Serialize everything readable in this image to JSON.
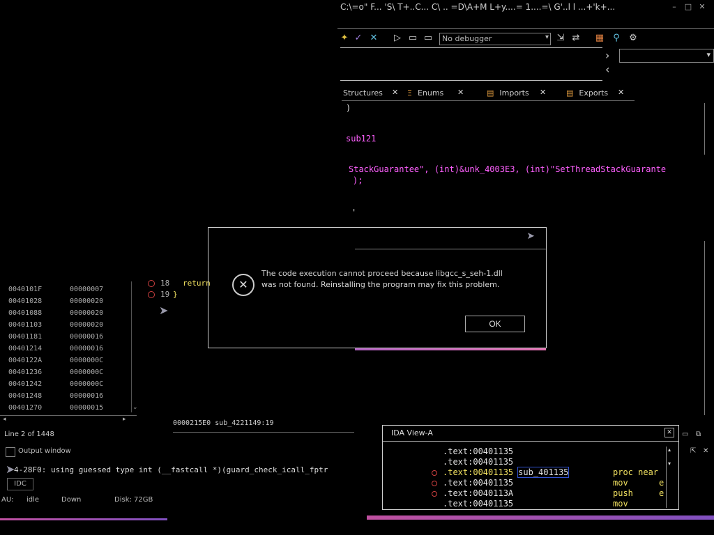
{
  "window": {
    "title": "C:\\=o\" F... 'S\\ T+..C... C\\ .. =D\\A+M L+y....= 1....=\\ G'..l  l ...+'k+...",
    "controls": [
      "–",
      "□",
      "✕"
    ]
  },
  "toolbar": {
    "debugger_select": "No debugger",
    "icons": [
      "wand-icon",
      "check-icon",
      "cross-icon",
      "play-icon",
      "pause-icon",
      "stop-icon",
      "step-icon",
      "trace-icon",
      "plugin-icon",
      "graph-icon",
      "settings-icon"
    ]
  },
  "tabs": [
    {
      "label": "Structures"
    },
    {
      "label": "Enums"
    },
    {
      "label": "Imports"
    },
    {
      "label": "Exports"
    }
  ],
  "pseudocode": {
    "line_brace": ")",
    "line_sub": "sub121",
    "line_call_prefix": "StackGuarantee\", (int)&unk_4003E3, (int)\"SetThreadStackGuarante",
    "line_semicolon": ");",
    "line_tick": "'",
    "line18_num": "18",
    "line18_text": "return",
    "line19_num": "19",
    "line19_text": "}"
  },
  "dialog": {
    "message": "The code execution cannot proceed because libgcc_s_seh-1.dll was not found. Reinstalling the program may fix this problem.",
    "ok_label": "OK"
  },
  "functions": {
    "rows": [
      {
        "addr": "0040101F",
        "len": "00000007"
      },
      {
        "addr": "00401028",
        "len": "00000020"
      },
      {
        "addr": "00401088",
        "len": "00000020"
      },
      {
        "addr": "00401103",
        "len": "00000020"
      },
      {
        "addr": "00401181",
        "len": "00000016"
      },
      {
        "addr": "00401214",
        "len": "00000016"
      },
      {
        "addr": "0040122A",
        "len": "0000000C"
      },
      {
        "addr": "00401236",
        "len": "0000000C"
      },
      {
        "addr": "00401242",
        "len": "0000000C"
      },
      {
        "addr": "00401248",
        "len": "00000016"
      },
      {
        "addr": "00401270",
        "len": "00000015"
      }
    ],
    "line_count": "Line 2 of 1448"
  },
  "pseudo_status": "0000215E0  sub_4221149:19",
  "output": {
    "title": "Output window",
    "line": "4-28F0: using guessed type int (__fastcall *)(guard_check_icall_fptr",
    "idc_label": "IDC"
  },
  "statusbar": {
    "au": "AU:",
    "state": "idle",
    "dir": "Down",
    "disk": "Disk: 72GB"
  },
  "ida_view": {
    "title": "IDA View-A",
    "rows": [
      {
        "addr": ".text:00401135",
        "label": "",
        "mnem": "",
        "op": "",
        "bp": false,
        "hl": false
      },
      {
        "addr": ".text:00401135",
        "label": "",
        "mnem": "",
        "op": "",
        "bp": false,
        "hl": false
      },
      {
        "addr": ".text:00401135",
        "label": "sub_401135",
        "mnem": "proc near",
        "op": "",
        "bp": true,
        "hl": true
      },
      {
        "addr": ".text:00401135",
        "label": "",
        "mnem": "mov",
        "op": "e",
        "bp": true,
        "hl": false
      },
      {
        "addr": ".text:0040113A",
        "label": "",
        "mnem": "push",
        "op": "e",
        "bp": true,
        "hl": false
      },
      {
        "addr": ".text:00401135",
        "label": "",
        "mnem": "mov",
        "op": "",
        "bp": false,
        "hl": false
      }
    ]
  },
  "colors": {
    "accent_pink": "#ff60ff",
    "text_yellow": "#f0e060",
    "breakpoint_red": "#d04040",
    "highlight_blue": "#3050d0"
  }
}
